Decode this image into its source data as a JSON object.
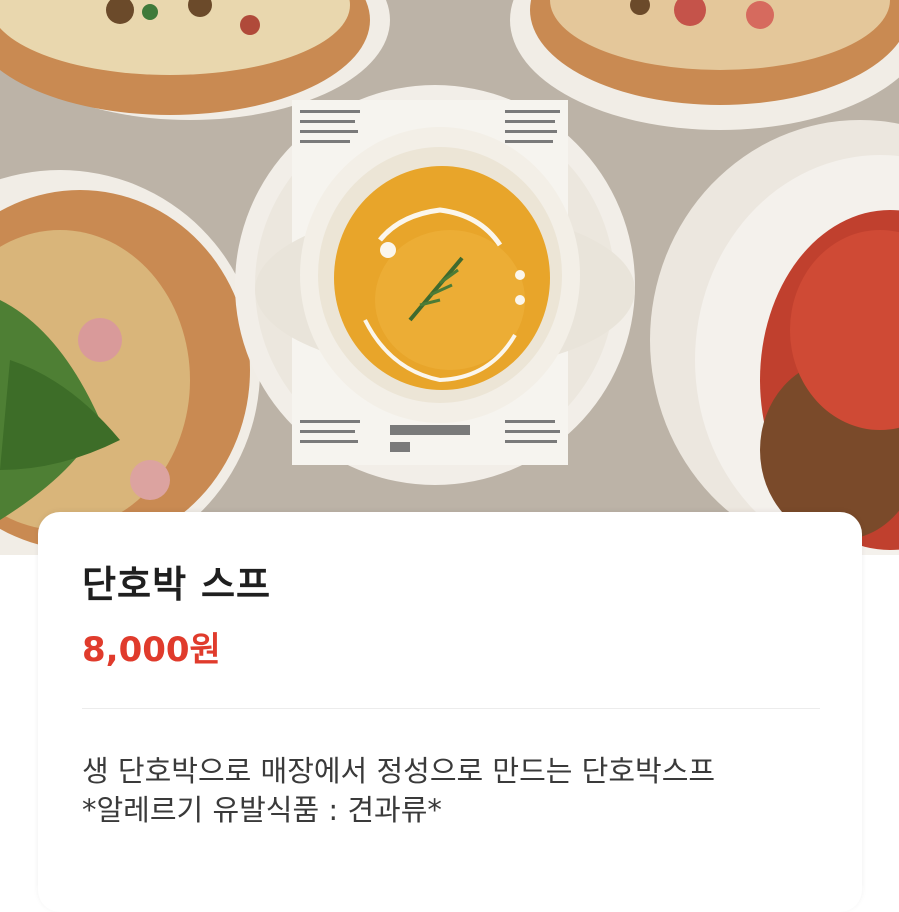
{
  "product": {
    "image_alt": "단호박 스프",
    "name": "단호박 스프",
    "price": "8,000원",
    "description": [
      "생 단호박으로 매장에서 정성으로 만드는 단호박스프",
      "*알레르기 유발식품 : 견과류*"
    ]
  },
  "colors": {
    "price": "#e03b2c",
    "title": "#1f1f1f",
    "body_text": "#3a3a3a",
    "soup": "#e8a52a",
    "table": "#b9b0a4"
  }
}
